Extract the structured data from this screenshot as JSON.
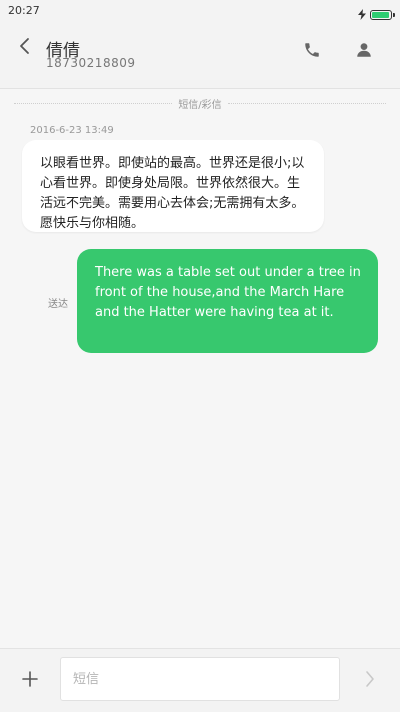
{
  "status_bar": {
    "time": "20:27",
    "battery_level": 0.95,
    "charging_icon": "bolt-icon",
    "battery_color": "#2ecc71"
  },
  "header": {
    "contact_name": "倩倩",
    "contact_number": "18730218809",
    "back_icon": "chevron-left-icon",
    "call_icon": "phone-icon",
    "profile_icon": "person-icon"
  },
  "thread": {
    "divider_label": "短信/彩信",
    "timestamp": "2016-6-23 13:49",
    "messages": [
      {
        "direction": "incoming",
        "text": "以眼看世界。即使站的最高。世界还是很小;以心看世界。即使身处局限。世界依然很大。生活远不完美。需要用心去体会;无需拥有太多。愿快乐与你相随。"
      },
      {
        "direction": "outgoing",
        "text": "There was a table set out under a tree in front of the house,and the March Hare and the Hatter were having tea at it.",
        "status": "送达",
        "bubble_color": "#37c86e"
      }
    ]
  },
  "composer": {
    "placeholder": "短信",
    "value": "",
    "add_icon": "plus-icon",
    "send_icon": "chevron-right-icon"
  }
}
